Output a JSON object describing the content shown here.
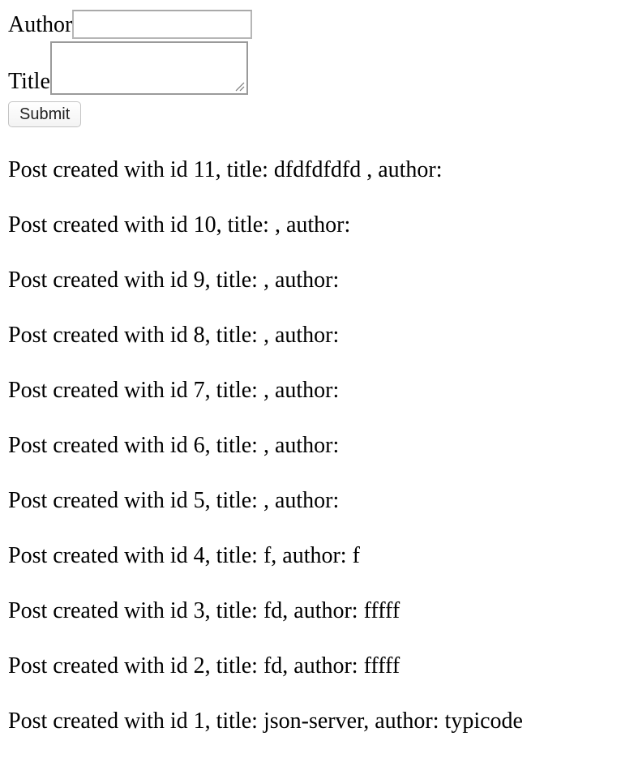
{
  "form": {
    "author_label": "Author",
    "author_value": "",
    "title_label": "Title",
    "title_value": "",
    "submit_label": "Submit"
  },
  "posts": [
    "Post created with id 11, title: dfdfdfdfd , author:",
    "Post created with id 10, title: , author:",
    "Post created with id 9, title: , author:",
    "Post created with id 8, title: , author:",
    "Post created with id 7, title: , author:",
    "Post created with id 6, title: , author:",
    "Post created with id 5, title: , author:",
    "Post created with id 4, title: f, author: f",
    "Post created with id 3, title: fd, author: fffff",
    "Post created with id 2, title: fd, author: fffff",
    "Post created with id 1, title: json-server, author: typicode"
  ]
}
